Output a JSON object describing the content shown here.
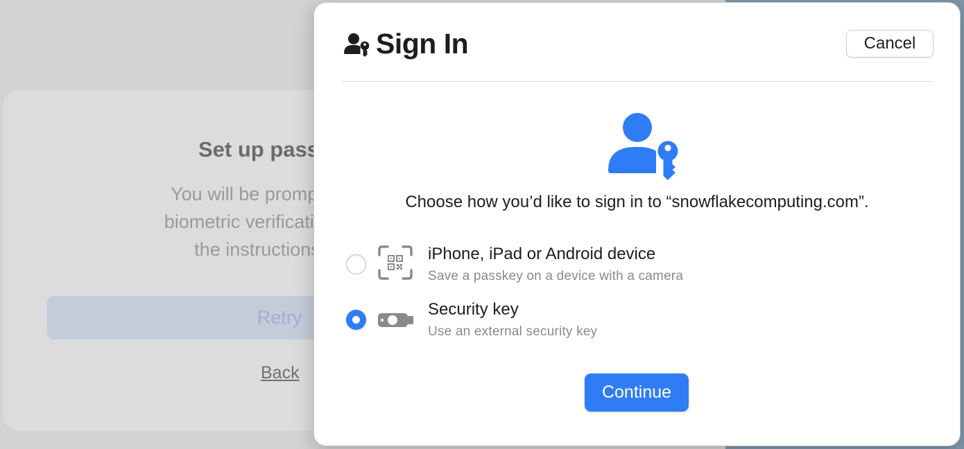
{
  "background": {
    "title": "Set up pass",
    "description_lines": [
      "You will be prompted to us",
      "biometric verification (face c",
      "the instructions to co"
    ],
    "retry_label": "Retry",
    "back_label": "Back"
  },
  "dialog": {
    "title": "Sign In",
    "header_icon": "person-key-icon",
    "cancel_label": "Cancel",
    "hero_icon": "person-key-icon",
    "prompt": "Choose how you’d like to sign in to “snowflakecomputing.com”.",
    "options": [
      {
        "icon": "qr-code-scan-icon",
        "label": "iPhone, iPad or Android device",
        "sublabel": "Save a passkey on a device with a camera",
        "selected": false
      },
      {
        "icon": "security-key-icon",
        "label": "Security key",
        "sublabel": "Use an external security key",
        "selected": true
      }
    ],
    "continue_label": "Continue"
  },
  "colors": {
    "accent": "#2f7df6",
    "backdrop": "#d3d3d3",
    "dialog_bg": "#ffffff",
    "secondary_text": "#8a8a8e"
  }
}
